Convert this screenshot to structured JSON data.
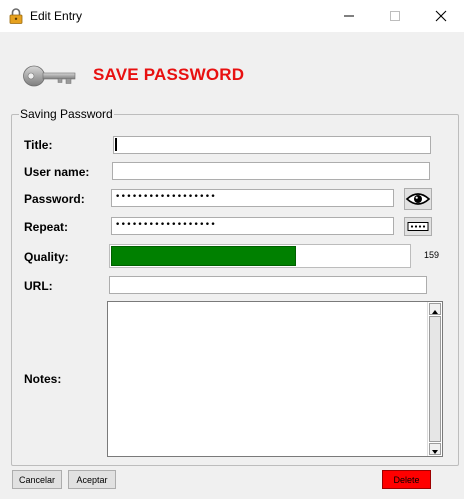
{
  "window": {
    "title": "Edit Entry"
  },
  "header": {
    "title": "SAVE PASSWORD"
  },
  "form": {
    "group_label": "Saving Password",
    "title": {
      "label": "Title:",
      "value": ""
    },
    "username": {
      "label": "User name:",
      "value": ""
    },
    "password": {
      "label": "Password:",
      "masked": "••••••••••••••••••"
    },
    "repeat": {
      "label": "Repeat:",
      "masked": "••••••••••••••••••"
    },
    "quality": {
      "label": "Quality:",
      "value": 159,
      "fill_fraction": 0.62,
      "fill_color": "#008000"
    },
    "url": {
      "label": "URL:",
      "value": ""
    },
    "notes": {
      "label": "Notes:",
      "value": ""
    }
  },
  "buttons": {
    "cancel": "Cancelar",
    "ok": "Aceptar",
    "delete": "Delete"
  },
  "colors": {
    "header_title": "#e81010",
    "delete_button": "#ff0000"
  },
  "icons": [
    "lock-icon",
    "key-icon",
    "eye-icon",
    "dots-icon"
  ]
}
